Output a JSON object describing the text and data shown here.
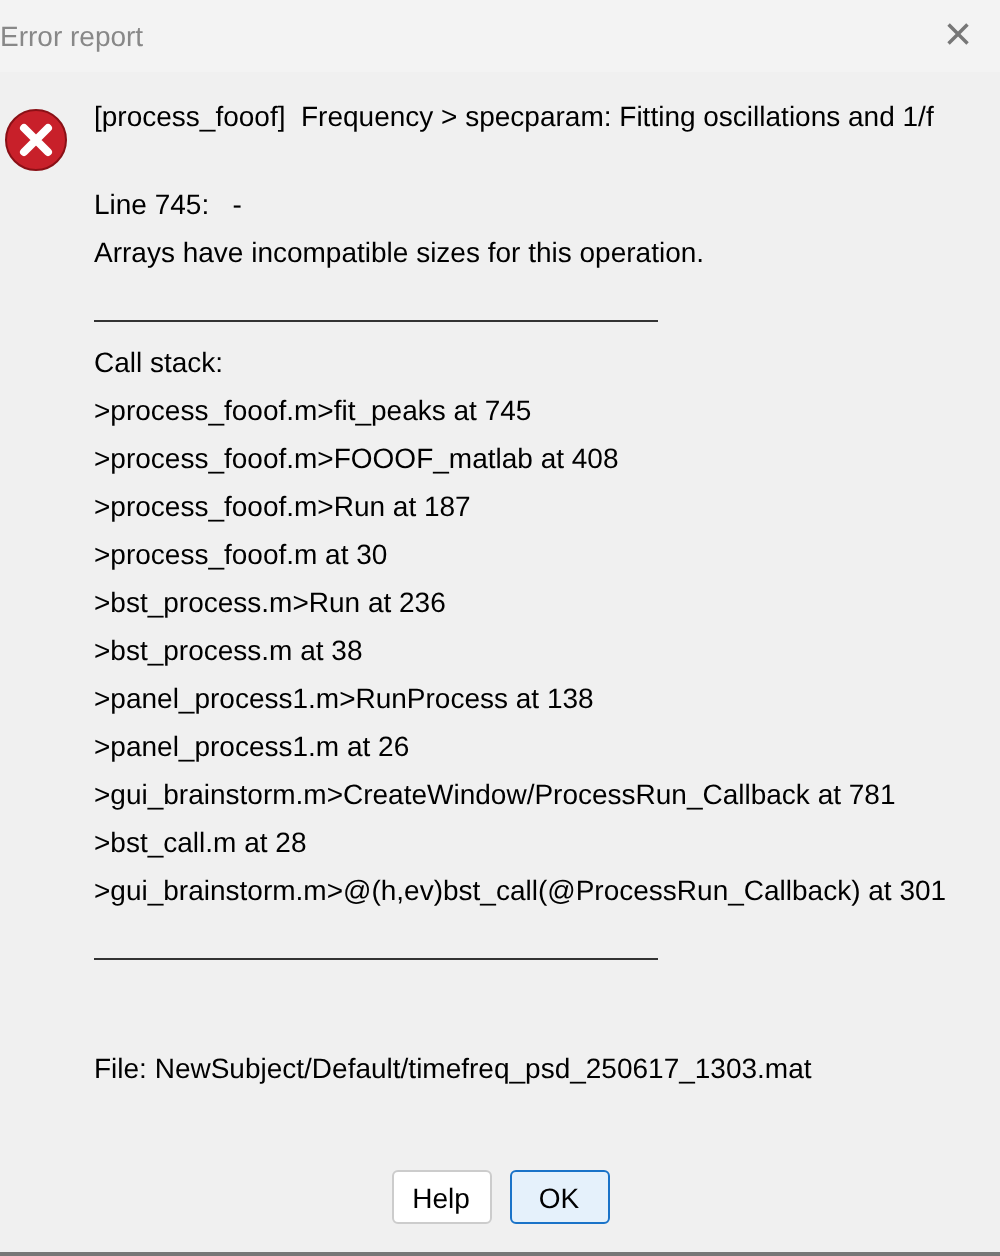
{
  "window": {
    "title": "Error report",
    "close": "×"
  },
  "message": {
    "header": "[process_fooof]  Frequency > specparam: Fitting oscillations and 1/f",
    "line": "Line 745:   -",
    "error": "Arrays have incompatible sizes for this operation."
  },
  "call_stack": {
    "title": "Call stack:",
    "entries": [
      ">process_fooof.m>fit_peaks at 745",
      ">process_fooof.m>FOOOF_matlab at 408",
      ">process_fooof.m>Run at 187",
      ">process_fooof.m at 30",
      ">bst_process.m>Run at 236",
      ">bst_process.m at 38",
      ">panel_process1.m>RunProcess at 138",
      ">panel_process1.m at 26",
      ">gui_brainstorm.m>CreateWindow/ProcessRun_Callback at 781",
      ">bst_call.m at 28",
      ">gui_brainstorm.m>@(h,ev)bst_call(@ProcessRun_Callback) at 301"
    ]
  },
  "file": "File: NewSubject/Default/timefreq_psd_250617_1303.mat",
  "buttons": [
    {
      "label": "Help",
      "default": false
    },
    {
      "label": "OK",
      "default": true
    }
  ]
}
